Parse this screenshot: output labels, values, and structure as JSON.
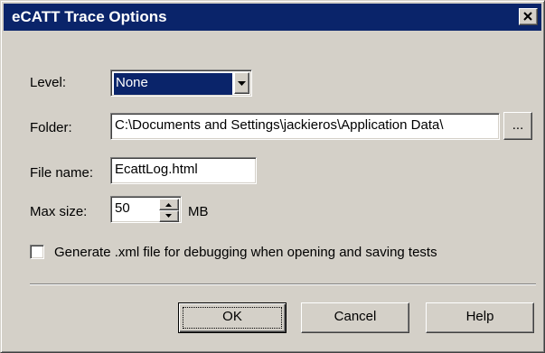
{
  "window": {
    "title": "eCATT Trace Options"
  },
  "level": {
    "label": "Level:",
    "value": "None"
  },
  "folder": {
    "label": "Folder:",
    "value": "C:\\Documents and Settings\\jackieros\\Application Data\\",
    "browse_label": "..."
  },
  "filename": {
    "label": "File name:",
    "value": "EcattLog.html"
  },
  "maxsize": {
    "label": "Max size:",
    "value": "50",
    "unit": "MB"
  },
  "debug_checkbox": {
    "label": "Generate .xml file for debugging when opening and saving tests",
    "checked": false
  },
  "buttons": {
    "ok": "OK",
    "cancel": "Cancel",
    "help": "Help"
  },
  "colors": {
    "titlebar": "#0a246a",
    "face": "#d4d0c8",
    "selection": "#0a246a"
  },
  "icons": [
    "close-icon",
    "dropdown-arrow-icon",
    "spin-up-icon",
    "spin-down-icon"
  ]
}
